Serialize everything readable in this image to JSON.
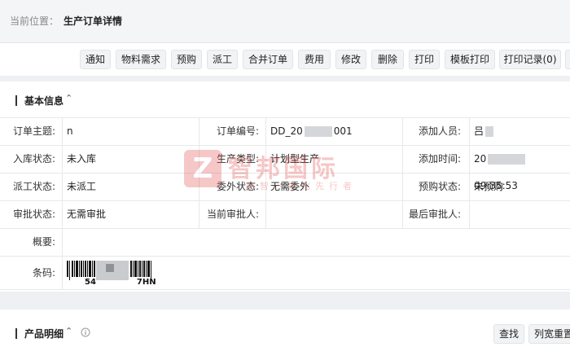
{
  "breadcrumb": {
    "label": "当前位置：",
    "current": "生产订单详情"
  },
  "toolbar": {
    "buttons": [
      "通知",
      "物料需求",
      "预购",
      "派工",
      "合并订单",
      "费用",
      "修改",
      "删除",
      "打印",
      "模板打印",
      "打印记录(0)"
    ]
  },
  "basic_info": {
    "title": "基本信息",
    "rows": [
      [
        {
          "label": "订单主题:",
          "value": "n"
        },
        {
          "label": "订单编号:",
          "value": "DD_20",
          "value2": "001"
        },
        {
          "label": "添加人员:",
          "value": "吕"
        }
      ],
      [
        {
          "label": "入库状态:",
          "value": "未入库"
        },
        {
          "label": "生产类型:",
          "value": "计划型生产"
        },
        {
          "label": "添加时间:",
          "value": "20",
          "value2": "09:35:53"
        }
      ],
      [
        {
          "label": "派工状态:",
          "value": "未派工"
        },
        {
          "label": "委外状态:",
          "value": "无需委外"
        },
        {
          "label": "预购状态:",
          "value": "未预购"
        }
      ],
      [
        {
          "label": "审批状态:",
          "value": "无需审批"
        },
        {
          "label": "当前审批人:",
          "value": ""
        },
        {
          "label": "最后审批人:",
          "value": ""
        }
      ]
    ],
    "summary_label": "概要:",
    "barcode_label": "条码:",
    "barcode_text_start": "54",
    "barcode_text_end": "7HN"
  },
  "product_detail": {
    "title": "产品明细",
    "search_label": "查找",
    "reset_label": "列宽重置"
  },
  "watermark": {
    "logo": "Z",
    "name": "智邦国际",
    "slogan": "数智一体化先行者"
  },
  "colors": {
    "accent": "#e03a3a"
  }
}
